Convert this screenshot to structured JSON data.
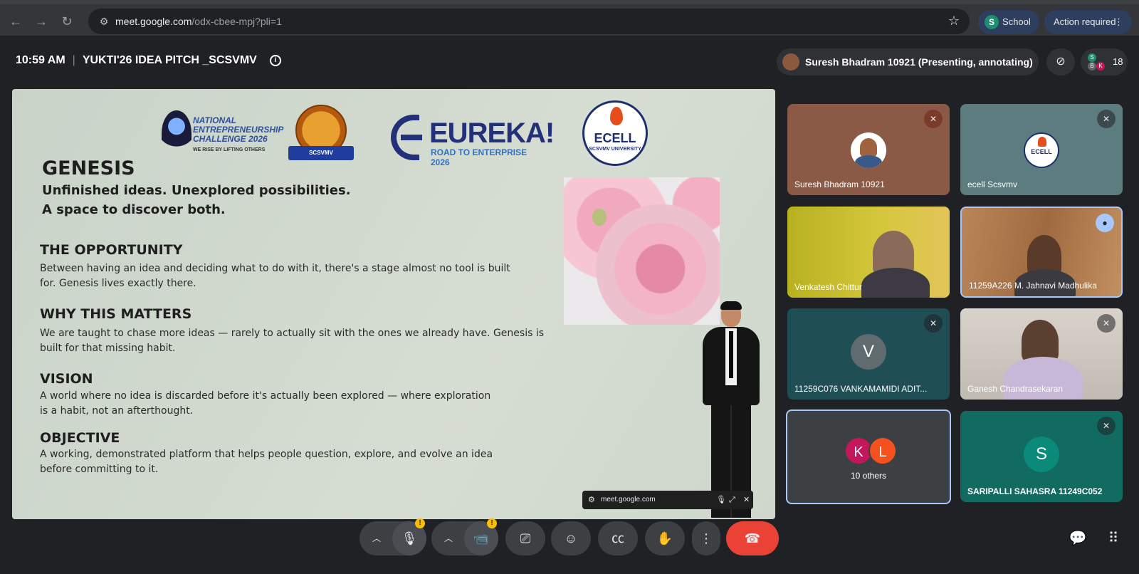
{
  "browser": {
    "url_host": "meet.google.com",
    "url_path": "/odx-cbee-mpj?pli=1",
    "profile_initial": "S",
    "profile_label": "School",
    "action_label": "Action required",
    "action_menu": "⋮"
  },
  "meeting": {
    "time": "10:59 AM",
    "separator": "|",
    "title": "YUKTI'26 IDEA PITCH _SCSVMV",
    "presenter_label": "Suresh Bhadram 10921 (Presenting, annotating)",
    "participant_count": "18",
    "people_initials": [
      "S",
      "B",
      "K"
    ]
  },
  "slide": {
    "logos": {
      "nec": [
        "NATIONAL",
        "ENTREPRENEURSHIP",
        "CHALLENGE 2026"
      ],
      "nec_tagline": "WE RISE BY LIFTING OTHERS",
      "scs_ribbon": "SCSVMV",
      "eureka_word": "EUREKA!",
      "eureka_sub": "ROAD TO ENTERPRISE 2026",
      "ecell_word": "ECELL",
      "ecell_sub": "SCSVMV UNIVERSITY"
    },
    "heading": "GENESIS",
    "tagline_1": "Unfinished ideas. Unexplored possibilities.",
    "tagline_2": "A space to discover both.",
    "sections": [
      {
        "title": "THE OPPORTUNITY",
        "line1": "Between having an idea and deciding what to do with it, there's a stage almost no tool is built",
        "line2": "for. Genesis lives exactly there."
      },
      {
        "title": "WHY THIS MATTERS",
        "line1": "We are taught to chase more ideas — rarely to actually sit with the ones we already have. Genesis is",
        "line2": "built for that missing habit."
      },
      {
        "title": "VISION",
        "line1": "A world where no idea is discarded before it's actually been explored — where exploration",
        "line2": "is a habit, not an afterthought."
      },
      {
        "title": "OBJECTIVE",
        "line1": "A working, demonstrated platform that helps people question, explore, and evolve an idea",
        "line2": "before committing to it."
      }
    ]
  },
  "mini_bar": {
    "label": "meet.google.com"
  },
  "tiles": [
    {
      "name": "Suresh Bhadram 10921",
      "muted": true
    },
    {
      "name": "ecell Scsvmv",
      "muted": true
    },
    {
      "name": "Venkatesh Chittur",
      "muted": false
    },
    {
      "name": "11259A226 M. Jahnavi Madhulika",
      "speaking": true
    },
    {
      "name": "11259C076 VANKAMAMIDI ADIT...",
      "initial": "V",
      "muted": true
    },
    {
      "name": "Ganesh Chandrasekaran",
      "muted": true
    },
    {
      "name": "10 others",
      "initials": [
        "K",
        "L"
      ]
    },
    {
      "name": "SARIPALLI SAHASRA 11249C052",
      "initial": "S",
      "muted": true
    }
  ],
  "toolbar": {
    "mic_warning": "!",
    "cam_warning": "!"
  },
  "colors": {
    "background": "#202124",
    "end_call": "#ea4335",
    "active_tile_border": "#a8c7fa"
  }
}
